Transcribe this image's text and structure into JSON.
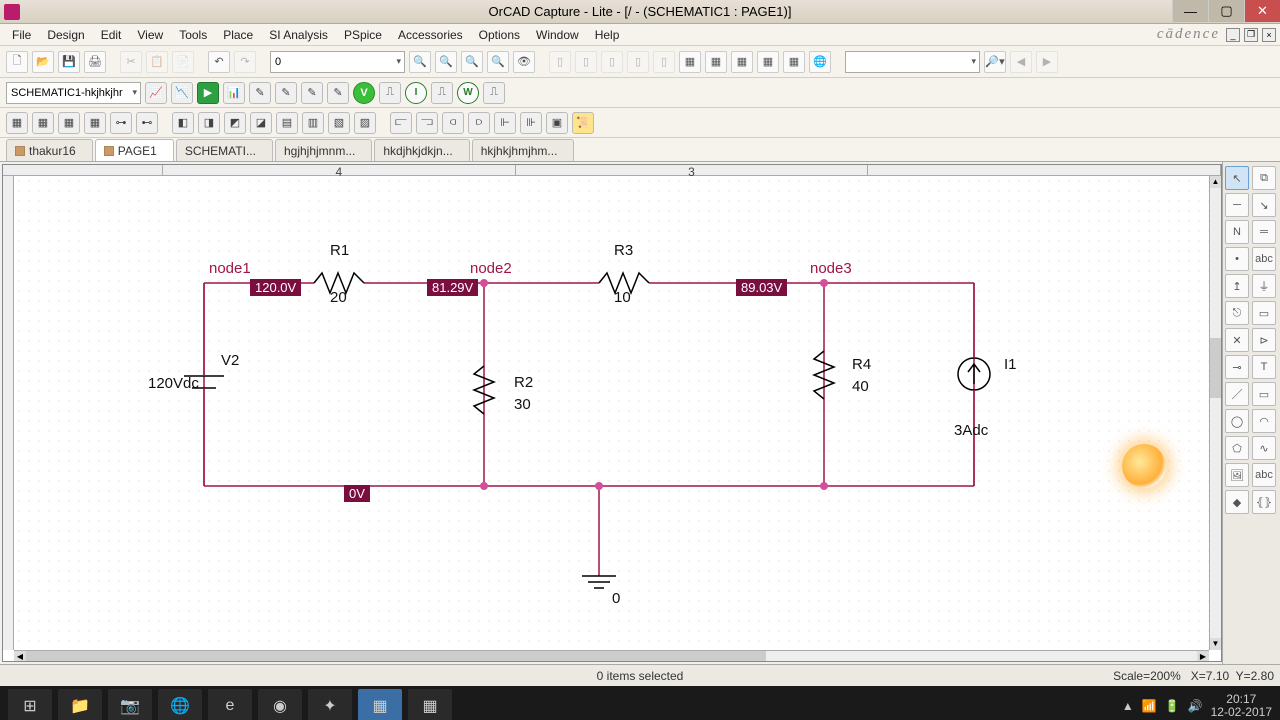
{
  "title": "OrCAD Capture - Lite - [/ - (SCHEMATIC1 : PAGE1)]",
  "brand": "cādence",
  "menus": {
    "file": "File",
    "design": "Design",
    "edit": "Edit",
    "view": "View",
    "tools": "Tools",
    "place": "Place",
    "si": "SI Analysis",
    "pspice": "PSpice",
    "acc": "Accessories",
    "opt": "Options",
    "win": "Window",
    "help": "Help"
  },
  "schemCombo": "SCHEMATIC1-hkjhkjhr",
  "zoomCombo": "0",
  "searchCombo": "",
  "tabs": {
    "t0": "thakur16",
    "t1": "PAGE1",
    "t2": "SCHEMATI...",
    "t3": "hgjhjhjmnm...",
    "t4": "hkdjhkjdkjn...",
    "t5": "hkjhkjhmjhm..."
  },
  "ruler": {
    "r1": "4",
    "r2": "3"
  },
  "status": {
    "items": "0 items selected",
    "scale": "Scale=200%",
    "x": "X=7.10",
    "y": "Y=2.80"
  },
  "circuit": {
    "node1": "node1",
    "node2": "node2",
    "node3": "node3",
    "v1": "120.0V",
    "v2": "81.29V",
    "v3": "89.03V",
    "v0": "0V",
    "r1": "R1",
    "r1v": "20",
    "r2": "R2",
    "r2v": "30",
    "r3": "R3",
    "r3v": "10",
    "r4": "R4",
    "r4v": "40",
    "vsrc": "V2",
    "vsrcv": "120Vdc",
    "isrc": "I1",
    "isrcv": "3Adc",
    "gnd": "0"
  },
  "clock": {
    "time": "20:17",
    "date": "12-02-2017"
  }
}
